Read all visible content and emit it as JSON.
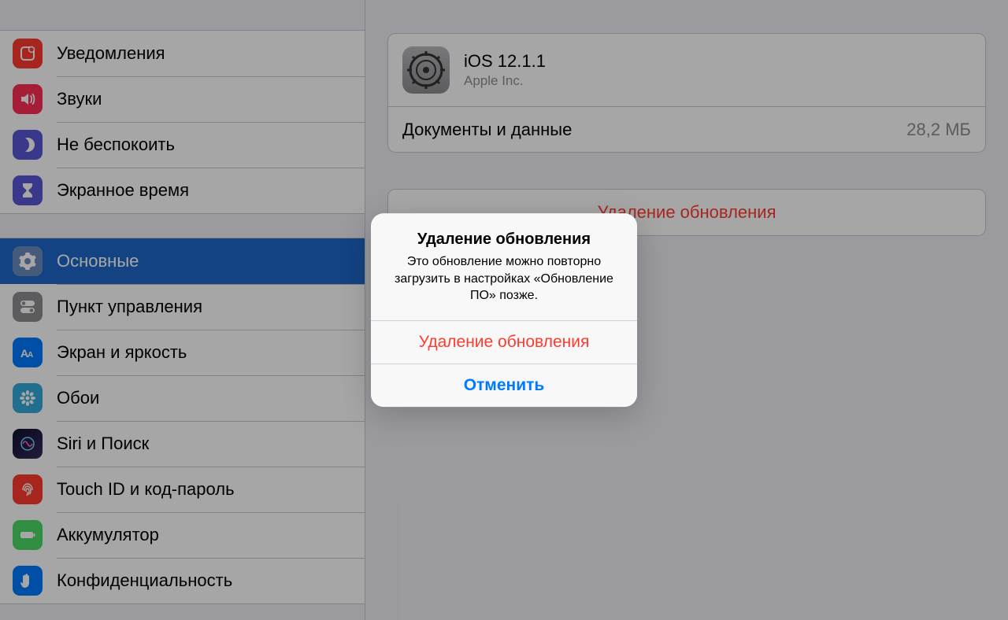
{
  "sidebar": {
    "groups": [
      {
        "items": [
          {
            "id": "notifications",
            "label": "Уведомления"
          },
          {
            "id": "sounds",
            "label": "Звуки"
          },
          {
            "id": "dnd",
            "label": "Не беспокоить"
          },
          {
            "id": "screentime",
            "label": "Экранное время"
          }
        ]
      },
      {
        "items": [
          {
            "id": "general",
            "label": "Основные",
            "selected": true
          },
          {
            "id": "controlcenter",
            "label": "Пункт управления"
          },
          {
            "id": "display",
            "label": "Экран и яркость"
          },
          {
            "id": "wallpaper",
            "label": "Обои"
          },
          {
            "id": "siri",
            "label": "Siri и Поиск"
          },
          {
            "id": "touchid",
            "label": "Touch ID и код-пароль"
          },
          {
            "id": "battery",
            "label": "Аккумулятор"
          },
          {
            "id": "privacy",
            "label": "Конфиденциальность"
          }
        ]
      }
    ]
  },
  "main": {
    "update": {
      "name": "iOS 12.1.1",
      "vendor": "Apple Inc."
    },
    "documents": {
      "label": "Документы и данные",
      "value": "28,2 МБ"
    },
    "delete_label": "Удаление обновления"
  },
  "alert": {
    "title": "Удаление обновления",
    "message": "Это обновление можно повторно загрузить в настройках «Обновление ПО» позже.",
    "destructive": "Удаление обновления",
    "cancel": "Отменить"
  }
}
